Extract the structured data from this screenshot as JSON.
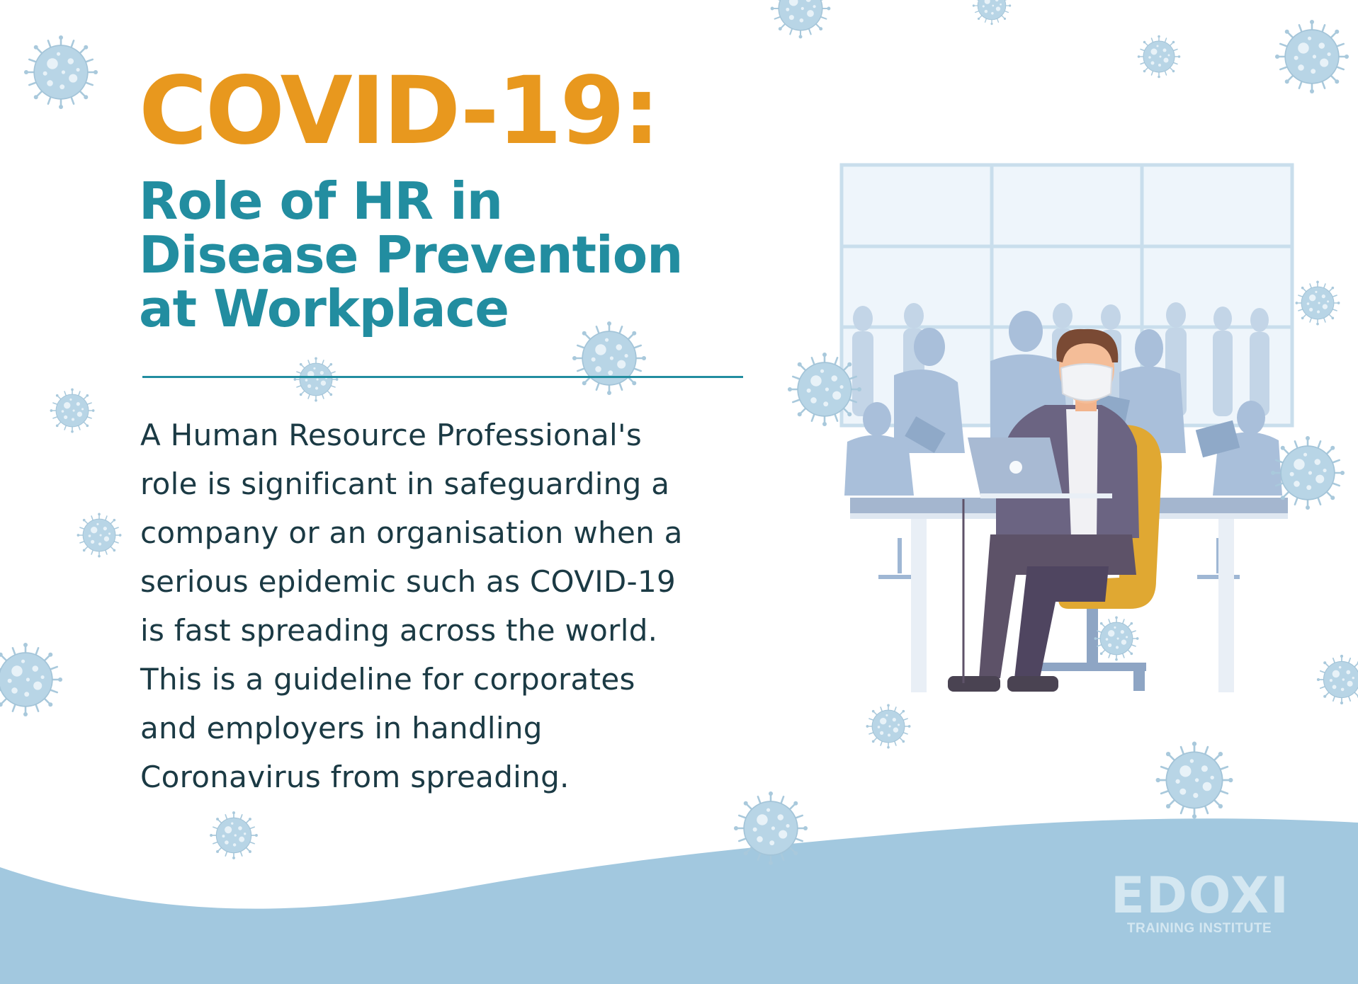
{
  "title": "COVID-19:",
  "subtitle_lines": [
    "Role of HR in",
    "Disease Prevention",
    "at Workplace"
  ],
  "body_lines": [
    "A Human Resource Professional's",
    "role is significant in safeguarding a",
    "company or an organisation when a",
    "serious epidemic such as COVID-19",
    "is fast spreading across the world.",
    "This is a guideline for corporates",
    "and employers in handling",
    "Coronavirus from spreading."
  ],
  "brand": {
    "name": "EDOXI",
    "tagline": "TRAINING INSTITUTE"
  },
  "colors": {
    "title": "#e8981e",
    "subtitle": "#228da0",
    "body": "#1b3a44",
    "wave": "#a2c8df",
    "virus": "#b8d5e6",
    "chair": "#e0a832",
    "suit": "#6b6482",
    "trousers": "#5d5268"
  },
  "illustration": {
    "subject": "masked office worker at laptop in meeting room",
    "icons": [
      "virus-icon",
      "office-window",
      "laptop-icon",
      "face-mask"
    ]
  }
}
